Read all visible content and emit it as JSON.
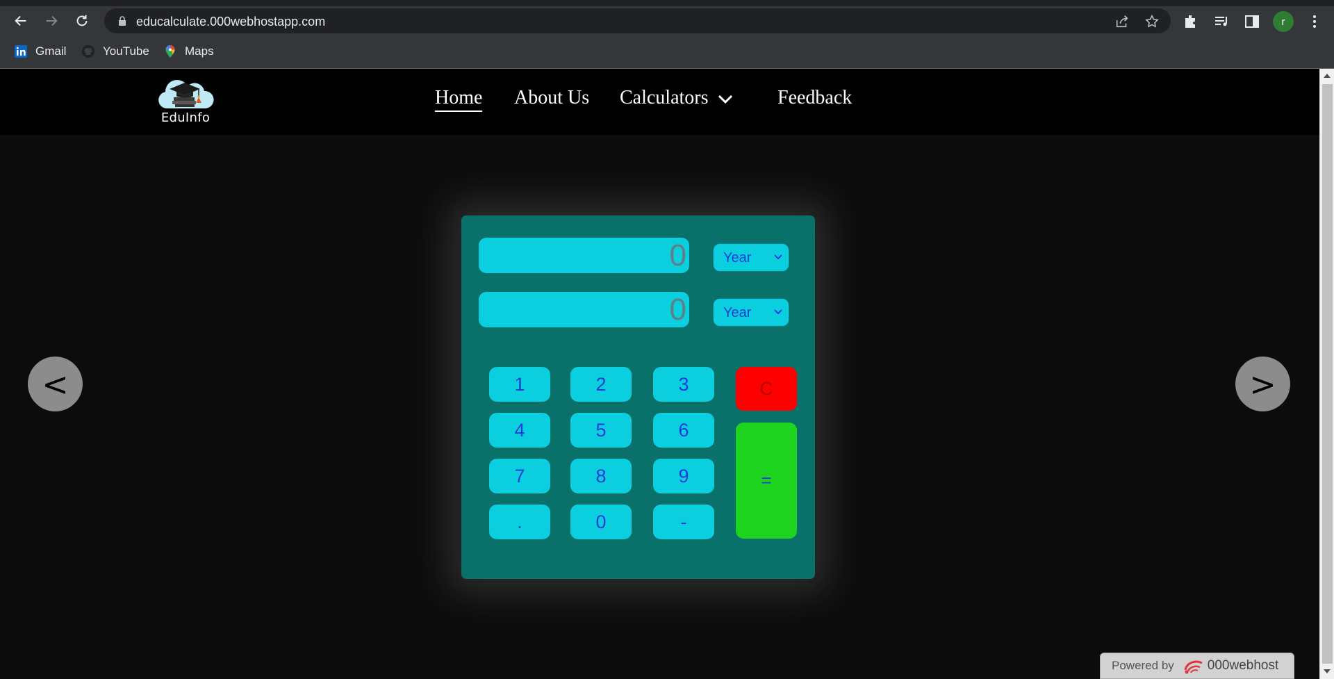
{
  "browser": {
    "url": "educalculate.000webhostapp.com",
    "avatar_letter": "r",
    "bookmarks": [
      {
        "label": "Gmail",
        "icon": "linkedin-icon"
      },
      {
        "label": "YouTube",
        "icon": "github-icon"
      },
      {
        "label": "Maps",
        "icon": "maps-pin-icon"
      }
    ]
  },
  "site": {
    "logo_text": "EduInfo",
    "nav": {
      "home": "Home",
      "about": "About Us",
      "calculators": "Calculators",
      "feedback": "Feedback"
    }
  },
  "slider": {
    "prev_label": "<",
    "next_label": ">"
  },
  "calculator": {
    "input1_value": "0",
    "input2_value": "0",
    "unit1": "Year",
    "unit2": "Year",
    "keys": [
      "1",
      "2",
      "3",
      "4",
      "5",
      "6",
      "7",
      "8",
      "9",
      ".",
      "0",
      "-"
    ],
    "clear_label": "C",
    "equals_label": "="
  },
  "footer_badge": {
    "prefix": "Powered by",
    "brand": "000webhost"
  },
  "colors": {
    "calc_body": "#09706a",
    "key_bg": "#0bcfdf",
    "key_text": "#1a3fd8",
    "clear_bg": "#ff0000",
    "equals_bg": "#1fd41f"
  }
}
